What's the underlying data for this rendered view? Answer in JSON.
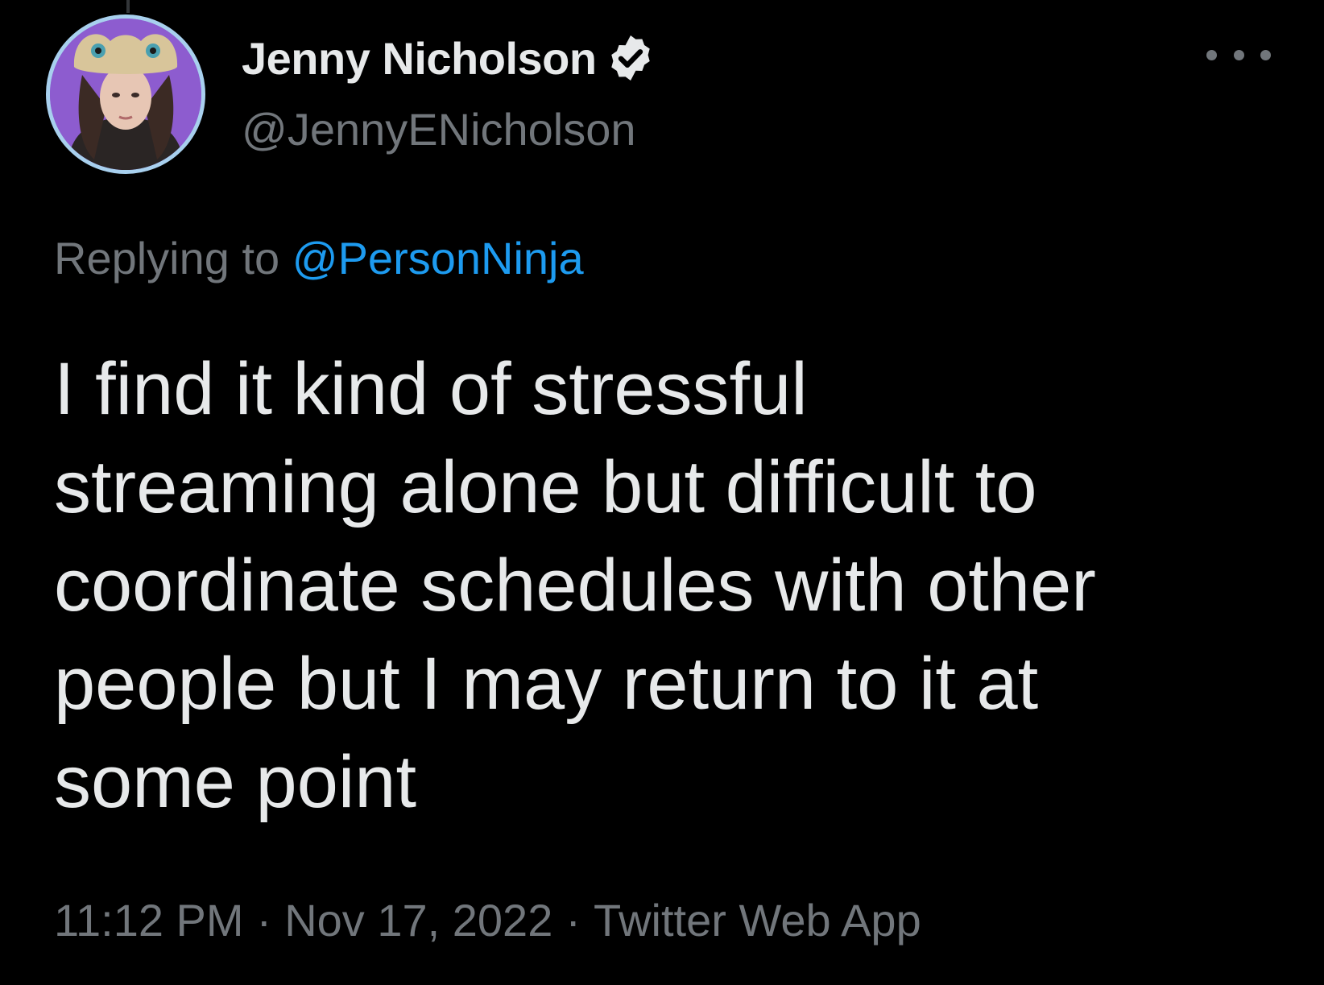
{
  "author": {
    "display_name": "Jenny Nicholson",
    "handle": "@JennyENicholson",
    "verified": true,
    "avatar_icon": "profile-photo"
  },
  "reply": {
    "prefix": "Replying to",
    "mention": "@PersonNinja"
  },
  "tweet": {
    "text": "I find it kind of stressful\nstreaming alone but difficult to\ncoordinate schedules with other\npeople but I may return to it at\nsome point"
  },
  "meta": {
    "time": "11:12 PM",
    "separator": "·",
    "date": "Nov 17, 2022",
    "source": "Twitter Web App"
  },
  "icons": {
    "verified": "verified-badge-icon",
    "more": "more-options-icon"
  },
  "colors": {
    "background": "#000000",
    "text": "#e7e9ea",
    "secondary": "#71767b",
    "link": "#1d9bf0",
    "avatar_ring": "#a8d0ee"
  }
}
